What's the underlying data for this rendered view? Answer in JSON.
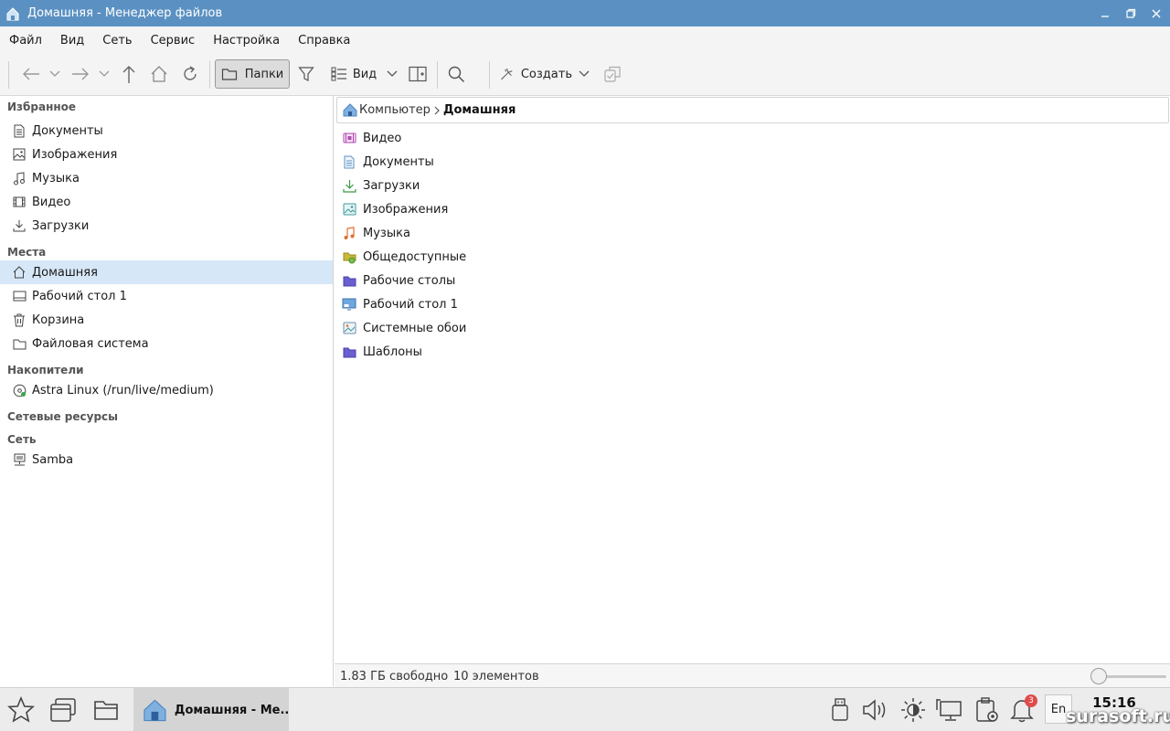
{
  "window": {
    "title": "Домашняя - Менеджер файлов"
  },
  "menu": [
    "Файл",
    "Вид",
    "Сеть",
    "Сервис",
    "Настройка",
    "Справка"
  ],
  "toolbar": {
    "folders_label": "Папки",
    "view_label": "Вид",
    "create_label": "Создать"
  },
  "sidebar": {
    "favorites_title": "Избранное",
    "favorites": [
      {
        "label": "Документы",
        "icon": "document-icon"
      },
      {
        "label": "Изображения",
        "icon": "image-icon"
      },
      {
        "label": "Музыка",
        "icon": "music-icon"
      },
      {
        "label": "Видео",
        "icon": "video-icon"
      },
      {
        "label": "Загрузки",
        "icon": "download-icon"
      }
    ],
    "places_title": "Места",
    "places": [
      {
        "label": "Домашняя",
        "icon": "home-icon",
        "active": true
      },
      {
        "label": "Рабочий стол 1",
        "icon": "desktop-icon"
      },
      {
        "label": "Корзина",
        "icon": "trash-icon"
      },
      {
        "label": "Файловая система",
        "icon": "folder-icon"
      }
    ],
    "drives_title": "Накопители",
    "drives": [
      {
        "label": "Astra Linux (/run/live/medium)",
        "icon": "disc-icon"
      }
    ],
    "network_resources_title": "Сетевые ресурсы",
    "network_title": "Сеть",
    "network": [
      {
        "label": "Samba",
        "icon": "network-icon"
      }
    ]
  },
  "breadcrumb": {
    "parent": "Компьютер",
    "current": "Домашняя"
  },
  "files": [
    {
      "label": "Видео",
      "icon": "video-folder-icon"
    },
    {
      "label": "Документы",
      "icon": "documents-folder-icon"
    },
    {
      "label": "Загрузки",
      "icon": "downloads-folder-icon"
    },
    {
      "label": "Изображения",
      "icon": "images-folder-icon"
    },
    {
      "label": "Музыка",
      "icon": "music-folder-icon"
    },
    {
      "label": "Общедоступные",
      "icon": "public-folder-icon"
    },
    {
      "label": "Рабочие столы",
      "icon": "folder-icon"
    },
    {
      "label": "Рабочий стол 1",
      "icon": "desktop-folder-icon"
    },
    {
      "label": "Системные обои",
      "icon": "wallpaper-folder-icon"
    },
    {
      "label": "Шаблоны",
      "icon": "folder-icon"
    }
  ],
  "status": {
    "free": "1.83 ГБ свободно",
    "count": "10 элементов",
    "zoom_fraction": 0.0
  },
  "taskbar": {
    "window_label": "Домашняя - Ме...",
    "notifications": "3",
    "lang": "En",
    "time": "15:16"
  },
  "watermark": "surasoft.ru",
  "colors": {
    "titlebar": "#5b91c2",
    "selection": "#d6e7f7",
    "folder": "#6a5fd0"
  }
}
